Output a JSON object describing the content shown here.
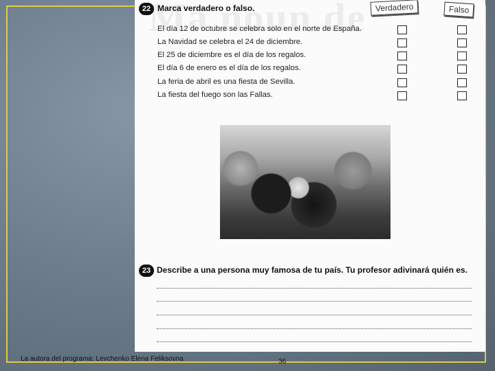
{
  "exercise22": {
    "number": "22",
    "title": "Marca verdadero o falso.",
    "true_label": "Verdadero",
    "false_label": "Falso",
    "statements": [
      "El día 12 de octubre se celebra solo en el norte de España.",
      "La Navidad se celebra el 24 de diciembre.",
      "El 25 de diciembre es el día de los regalos.",
      "El día 6 de enero es el día de los regalos.",
      "La feria de abril es una fiesta de Sevilla.",
      "La fiesta del fuego son las Fallas."
    ]
  },
  "exercise23": {
    "number": "23",
    "title": "Describe a una persona muy famosa de tu país. Tu profesor adivinará quién es."
  },
  "footer": {
    "author": "La autora del programa: Levchenko Elena Feliksovna",
    "page": "36"
  }
}
